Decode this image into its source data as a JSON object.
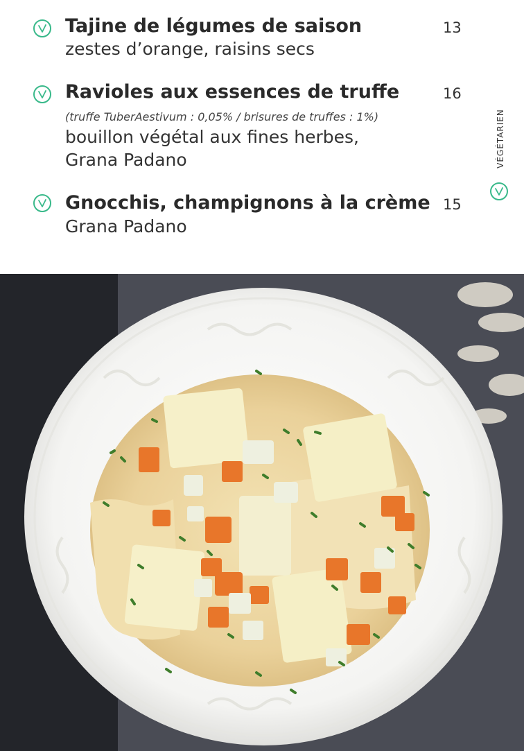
{
  "menu": {
    "items": [
      {
        "title": "Tajine de légumes de saison",
        "price": "13",
        "note": "",
        "desc": [
          "zestes d’orange, raisins secs"
        ]
      },
      {
        "title": "Ravioles aux essences de truffe",
        "price": "16",
        "note": "(truffe TuberAestivum : 0,05% / brisures de truffes : 1%)",
        "desc": [
          "bouillon végétal aux fines herbes,",
          "Grana Padano"
        ]
      },
      {
        "title": "Gnocchis, champignons à la crème",
        "price": "15",
        "note": "",
        "desc": [
          "Grana Padano"
        ]
      }
    ],
    "legend": {
      "label": "VÉGÉTARIEN",
      "icon": "vegetarian-icon"
    },
    "accent_color": "#39b98a"
  },
  "photo": {
    "subject": "ravioli-soup-photo"
  }
}
